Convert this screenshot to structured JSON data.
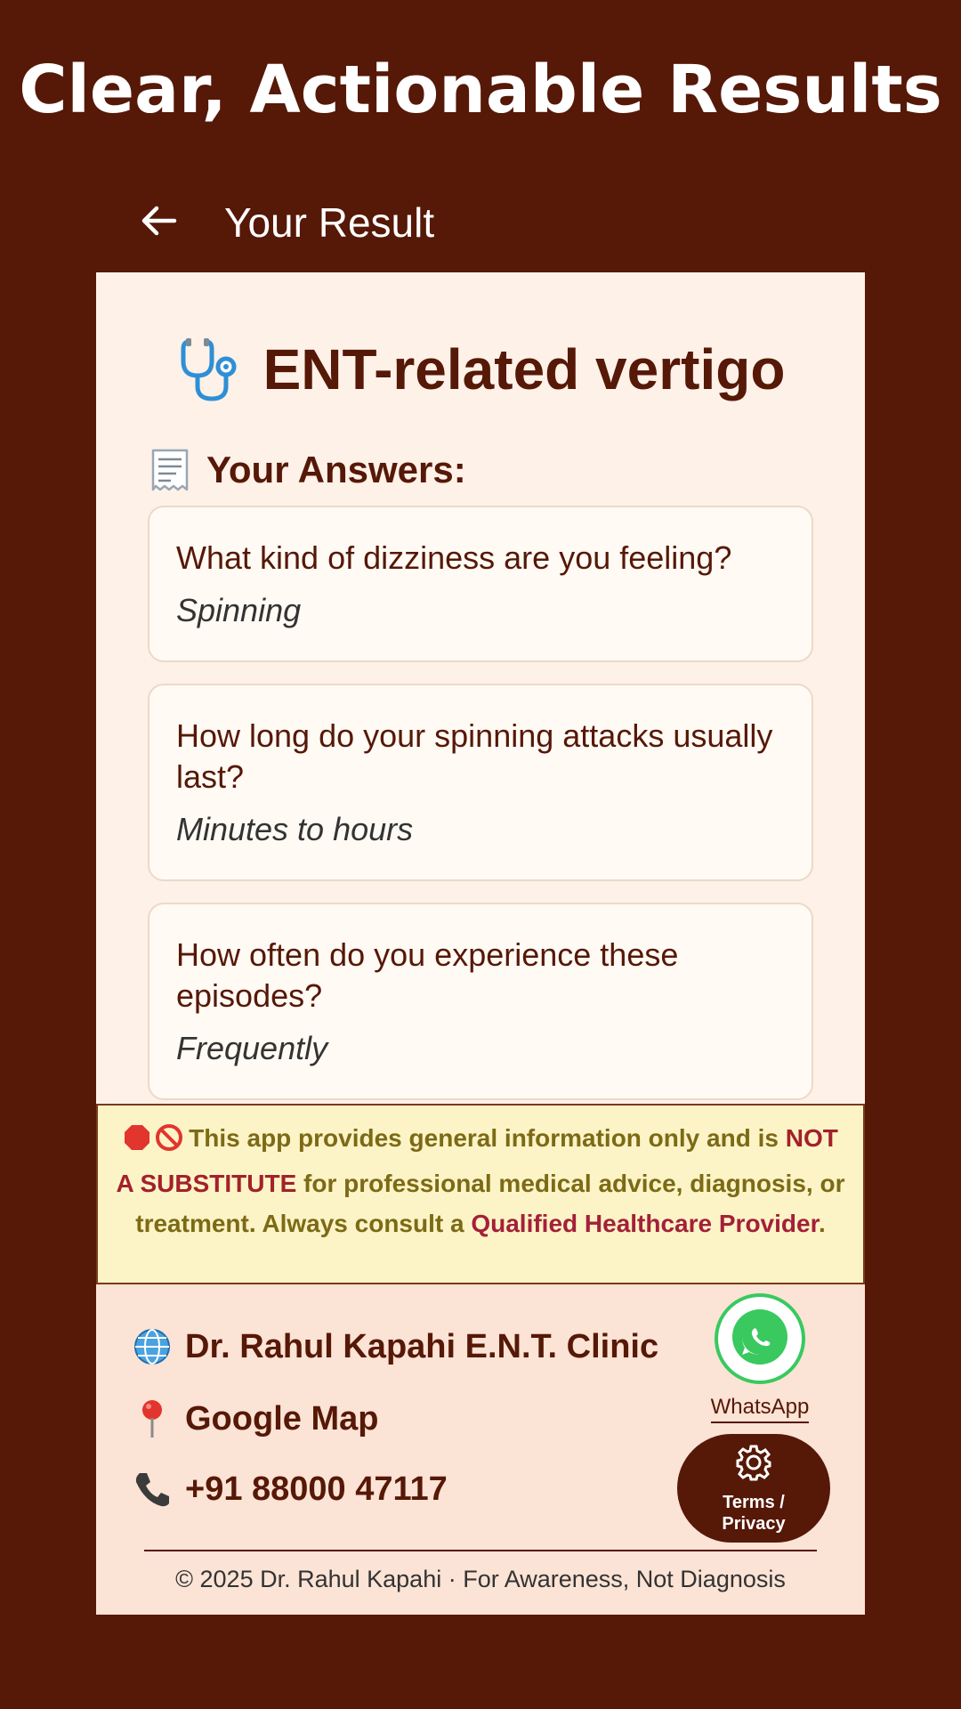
{
  "banner": {
    "headline": "Clear, Actionable Results"
  },
  "appbar": {
    "title": "Your Result",
    "back_icon": "arrow-left-icon"
  },
  "result": {
    "title": "ENT-related vertigo",
    "icon": "stethoscope-icon"
  },
  "answers": {
    "heading": "Your Answers:",
    "icon": "receipt-icon",
    "items": [
      {
        "question": "What kind of dizziness are you feeling?",
        "answer": "Spinning"
      },
      {
        "question": "How long do your spinning attacks usually last?",
        "answer": "Minutes to hours"
      },
      {
        "question": "How often do you experience these episodes?",
        "answer": "Frequently"
      }
    ]
  },
  "disclaimer": {
    "icons": [
      "stop-sign-icon",
      "prohibited-icon"
    ],
    "part1": "This app provides general information only and is ",
    "strong": "NOT A SUBSTITUTE",
    "part2": " for professional medical advice, diagnosis, or treatment. Always consult a ",
    "link": "Qualified Healthcare Provider",
    "part3": "."
  },
  "footer": {
    "clinic": {
      "label": "Dr. Rahul Kapahi E.N.T. Clinic",
      "icon": "globe-icon"
    },
    "map": {
      "label": "Google Map",
      "icon": "map-pin-icon"
    },
    "phone": {
      "label": "+91 88000 47117",
      "icon": "phone-icon"
    },
    "whatsapp": {
      "label": "WhatsApp",
      "icon": "whatsapp-icon"
    },
    "terms": {
      "line1": "Terms /",
      "line2": "Privacy",
      "icon": "gear-icon"
    },
    "copyright": "© 2025 Dr. Rahul Kapahi · For Awareness, Not Diagnosis"
  },
  "colors": {
    "background": "#561807",
    "panel": "#fdf1e8",
    "disclaimer_bg": "#fcf4c6",
    "footer_bg": "#fbe3d5",
    "whatsapp_green": "#39c95f",
    "warning_red": "#a3202c"
  }
}
